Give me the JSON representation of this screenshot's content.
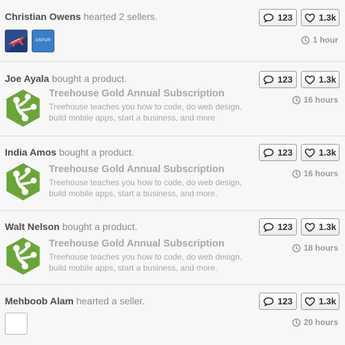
{
  "feed": {
    "items": [
      {
        "user": "Christian Owens",
        "action": "hearted 2 sellers.",
        "comments": "123",
        "hearts": "1.3k",
        "time": "1 hour",
        "sellers": [
          {
            "logo_text": ""
          },
          {
            "logo_text": "ASPUR"
          }
        ]
      },
      {
        "user": "Joe Ayala",
        "action": "bought a product.",
        "comments": "123",
        "hearts": "1.3k",
        "time": "16 hours",
        "product_title": "Treehouse Gold Annual Subscription",
        "product_desc": "Treehouse teaches you how to code, do web design, build mobile apps, start a business, and more."
      },
      {
        "user": "India Amos",
        "action": "bought a product.",
        "comments": "123",
        "hearts": "1.3k",
        "time": "16 hours",
        "product_title": "Treehouse Gold Annual Subscription",
        "product_desc": "Treehouse teaches you how to code, do web design, build mobile apps, start a business, and more."
      },
      {
        "user": "Walt Nelson",
        "action": "bought a product.",
        "comments": "123",
        "hearts": "1.3k",
        "time": "18 hours",
        "product_title": "Treehouse Gold Annual Subscription",
        "product_desc": "Treehouse teaches you how to code, do web design, build mobile apps, start a business, and more."
      },
      {
        "user": "Mehboob Alam",
        "action": "hearted a seller.",
        "comments": "123",
        "hearts": "1.3k",
        "time": "20 hours"
      }
    ]
  },
  "colors": {
    "treehouse_green": "#6ba53a",
    "text_name": "#4d4d4d",
    "text_muted": "#8c8c8c"
  },
  "icons": {
    "comment": "speech-bubble-icon",
    "heart": "heart-icon",
    "time": "clock-icon"
  }
}
